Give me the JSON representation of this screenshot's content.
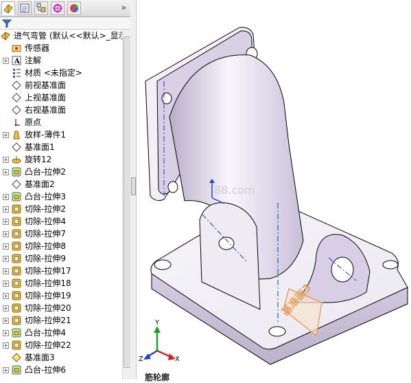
{
  "panel": {
    "tabs": [
      {
        "name": "feature-manager-tab-icon",
        "active": true
      },
      {
        "name": "property-manager-tab-icon",
        "active": false
      },
      {
        "name": "configuration-manager-tab-icon",
        "active": false
      },
      {
        "name": "dimxpert-manager-tab-icon",
        "active": false
      },
      {
        "name": "display-manager-tab-icon",
        "active": false
      }
    ],
    "more": "»"
  },
  "tree": [
    {
      "label": "进气弯管  (默认<<默认>_显示",
      "icon": "part-icon",
      "expander": "",
      "level": 0
    },
    {
      "label": "传感器",
      "icon": "sensors-folder-icon",
      "expander": "",
      "level": 1
    },
    {
      "label": "注解",
      "icon": "annotations-icon",
      "expander": "+",
      "level": 1
    },
    {
      "label": "材质 <未指定>",
      "icon": "material-icon",
      "expander": "",
      "level": 1
    },
    {
      "label": "前视基准面",
      "icon": "plane-icon",
      "expander": "",
      "level": 1
    },
    {
      "label": "上视基准面",
      "icon": "plane-icon",
      "expander": "",
      "level": 1
    },
    {
      "label": "右视基准面",
      "icon": "plane-icon",
      "expander": "",
      "level": 1
    },
    {
      "label": "原点",
      "icon": "origin-icon",
      "expander": "",
      "level": 1
    },
    {
      "label": "放样-薄件1",
      "icon": "loft-thin-icon",
      "expander": "+",
      "level": 1
    },
    {
      "label": "基准面1",
      "icon": "plane-icon",
      "expander": "",
      "level": 1
    },
    {
      "label": "旋转12",
      "icon": "revolve-icon",
      "expander": "+",
      "level": 1
    },
    {
      "label": "凸台-拉伸2",
      "icon": "boss-extrude-icon",
      "expander": "+",
      "level": 1
    },
    {
      "label": "基准面2",
      "icon": "plane-icon",
      "expander": "",
      "level": 1
    },
    {
      "label": "凸台-拉伸3",
      "icon": "boss-extrude-icon",
      "expander": "+",
      "level": 1
    },
    {
      "label": "切除-拉伸2",
      "icon": "cut-extrude-icon",
      "expander": "+",
      "level": 1
    },
    {
      "label": "切除-拉伸4",
      "icon": "cut-extrude-icon",
      "expander": "+",
      "level": 1
    },
    {
      "label": "切除-拉伸7",
      "icon": "cut-extrude-icon",
      "expander": "+",
      "level": 1
    },
    {
      "label": "切除-拉伸8",
      "icon": "cut-extrude-icon",
      "expander": "+",
      "level": 1
    },
    {
      "label": "切除-拉伸9",
      "icon": "cut-extrude-icon",
      "expander": "+",
      "level": 1
    },
    {
      "label": "切除-拉伸17",
      "icon": "cut-extrude-icon",
      "expander": "+",
      "level": 1
    },
    {
      "label": "切除-拉伸18",
      "icon": "cut-extrude-icon",
      "expander": "+",
      "level": 1
    },
    {
      "label": "切除-拉伸19",
      "icon": "cut-extrude-icon",
      "expander": "+",
      "level": 1
    },
    {
      "label": "切除-拉伸20",
      "icon": "cut-extrude-icon",
      "expander": "+",
      "level": 1
    },
    {
      "label": "切除-拉伸21",
      "icon": "cut-extrude-icon",
      "expander": "+",
      "level": 1
    },
    {
      "label": "凸台-拉伸4",
      "icon": "boss-extrude-icon",
      "expander": "+",
      "level": 1
    },
    {
      "label": "切除-拉伸22",
      "icon": "cut-extrude-icon",
      "expander": "+",
      "level": 1
    },
    {
      "label": "基准面3",
      "icon": "plane-highlighted-icon",
      "expander": "",
      "level": 1
    },
    {
      "label": "凸台-拉伸6",
      "icon": "boss-extrude-icon",
      "expander": "+",
      "level": 1
    }
  ],
  "viewport": {
    "plane_label": "基准面3",
    "watermark": "88.com",
    "triad": {
      "x": "X",
      "y": "Y",
      "z": "Z"
    },
    "bottom_label": "筋轮廓"
  },
  "colors": {
    "plane_orange": "#e8a060",
    "axis_red": "#d02020",
    "axis_green": "#20a020",
    "axis_blue": "#2040d0",
    "part_shade": "#cdc3dc"
  }
}
